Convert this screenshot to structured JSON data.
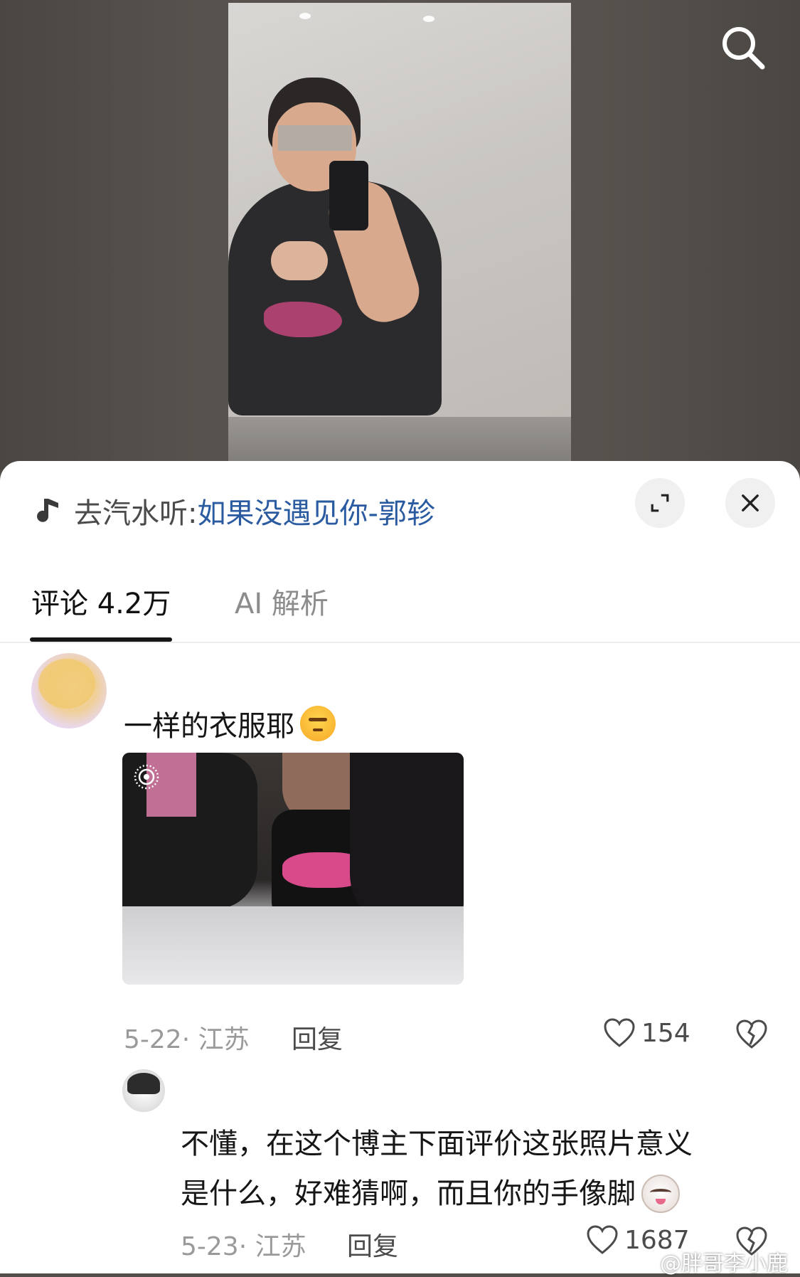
{
  "player": {
    "search_icon": "search-icon"
  },
  "sheet": {
    "music": {
      "icon": "music-note-icon",
      "prefix": "去汽水听:",
      "song": "如果没遇见你-郭轸"
    },
    "expand_icon": "expand-icon",
    "close_icon": "close-icon",
    "tabs": [
      {
        "label": "评论 4.2万",
        "active": true
      },
      {
        "label": "AI 解析",
        "active": false
      }
    ]
  },
  "comments": [
    {
      "text": "一样的衣服耶",
      "emoji": "smirk-emoji",
      "has_image": true,
      "image_badge": "live-photo-icon",
      "date_location": "5-22· 江苏",
      "reply": "回复",
      "likes": "154"
    },
    {
      "text_line1": "不懂，在这个博主下面评价这张照片意义",
      "text_line2": "是什么，好难猜啊，而且你的手像脚",
      "emoji": "cat-emoji",
      "date_location": "5-23· 江苏",
      "reply": "回复",
      "likes": "1687"
    }
  ],
  "watermark": "@胖哥李小鹿",
  "colors": {
    "link": "#2a5aa0",
    "muted": "#9a9a9a",
    "text": "#161616"
  }
}
